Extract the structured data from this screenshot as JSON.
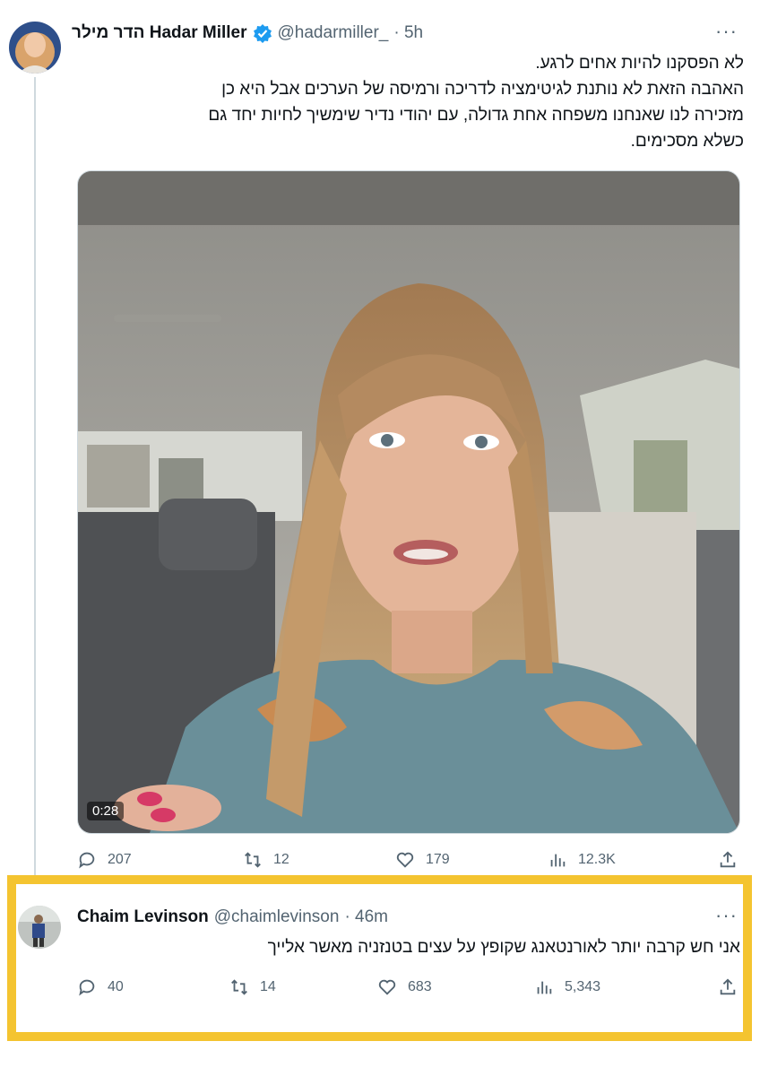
{
  "main_tweet": {
    "author_name": "הדר מילר Hadar Miller",
    "handle": "@hadarmiller_",
    "time": "· 5h",
    "text_lines": [
      "לא הפסקנו להיות אחים לרגע.",
      "האהבה הזאת לא נותנת לגיטימציה לדריכה ורמיסה של הערכים אבל היא כן",
      "מזכירה לנו שאנחנו משפחה אחת גדולה, עם יהודי נדיר שימשיך לחיות יחד גם",
      "כשלא מסכימים."
    ],
    "video_duration": "0:28",
    "stats": {
      "replies": "207",
      "retweets": "12",
      "likes": "179",
      "views": "12.3K"
    }
  },
  "reply_tweet": {
    "author_name": "Chaim Levinson",
    "handle": "@chaimlevinson",
    "time": "· 46m",
    "text": "אני חש קרבה יותר לאורנטאנג שקופץ על עצים בטנזניה מאשר אלייך",
    "stats": {
      "replies": "40",
      "retweets": "14",
      "likes": "683",
      "views": "5,343"
    }
  },
  "colors": {
    "accent": "#1d9bf0",
    "highlight_border": "#f4c430",
    "secondary_text": "#536471"
  },
  "icons": [
    "more-icon",
    "verified-icon",
    "reply-icon",
    "retweet-icon",
    "like-icon",
    "views-icon",
    "share-icon"
  ]
}
